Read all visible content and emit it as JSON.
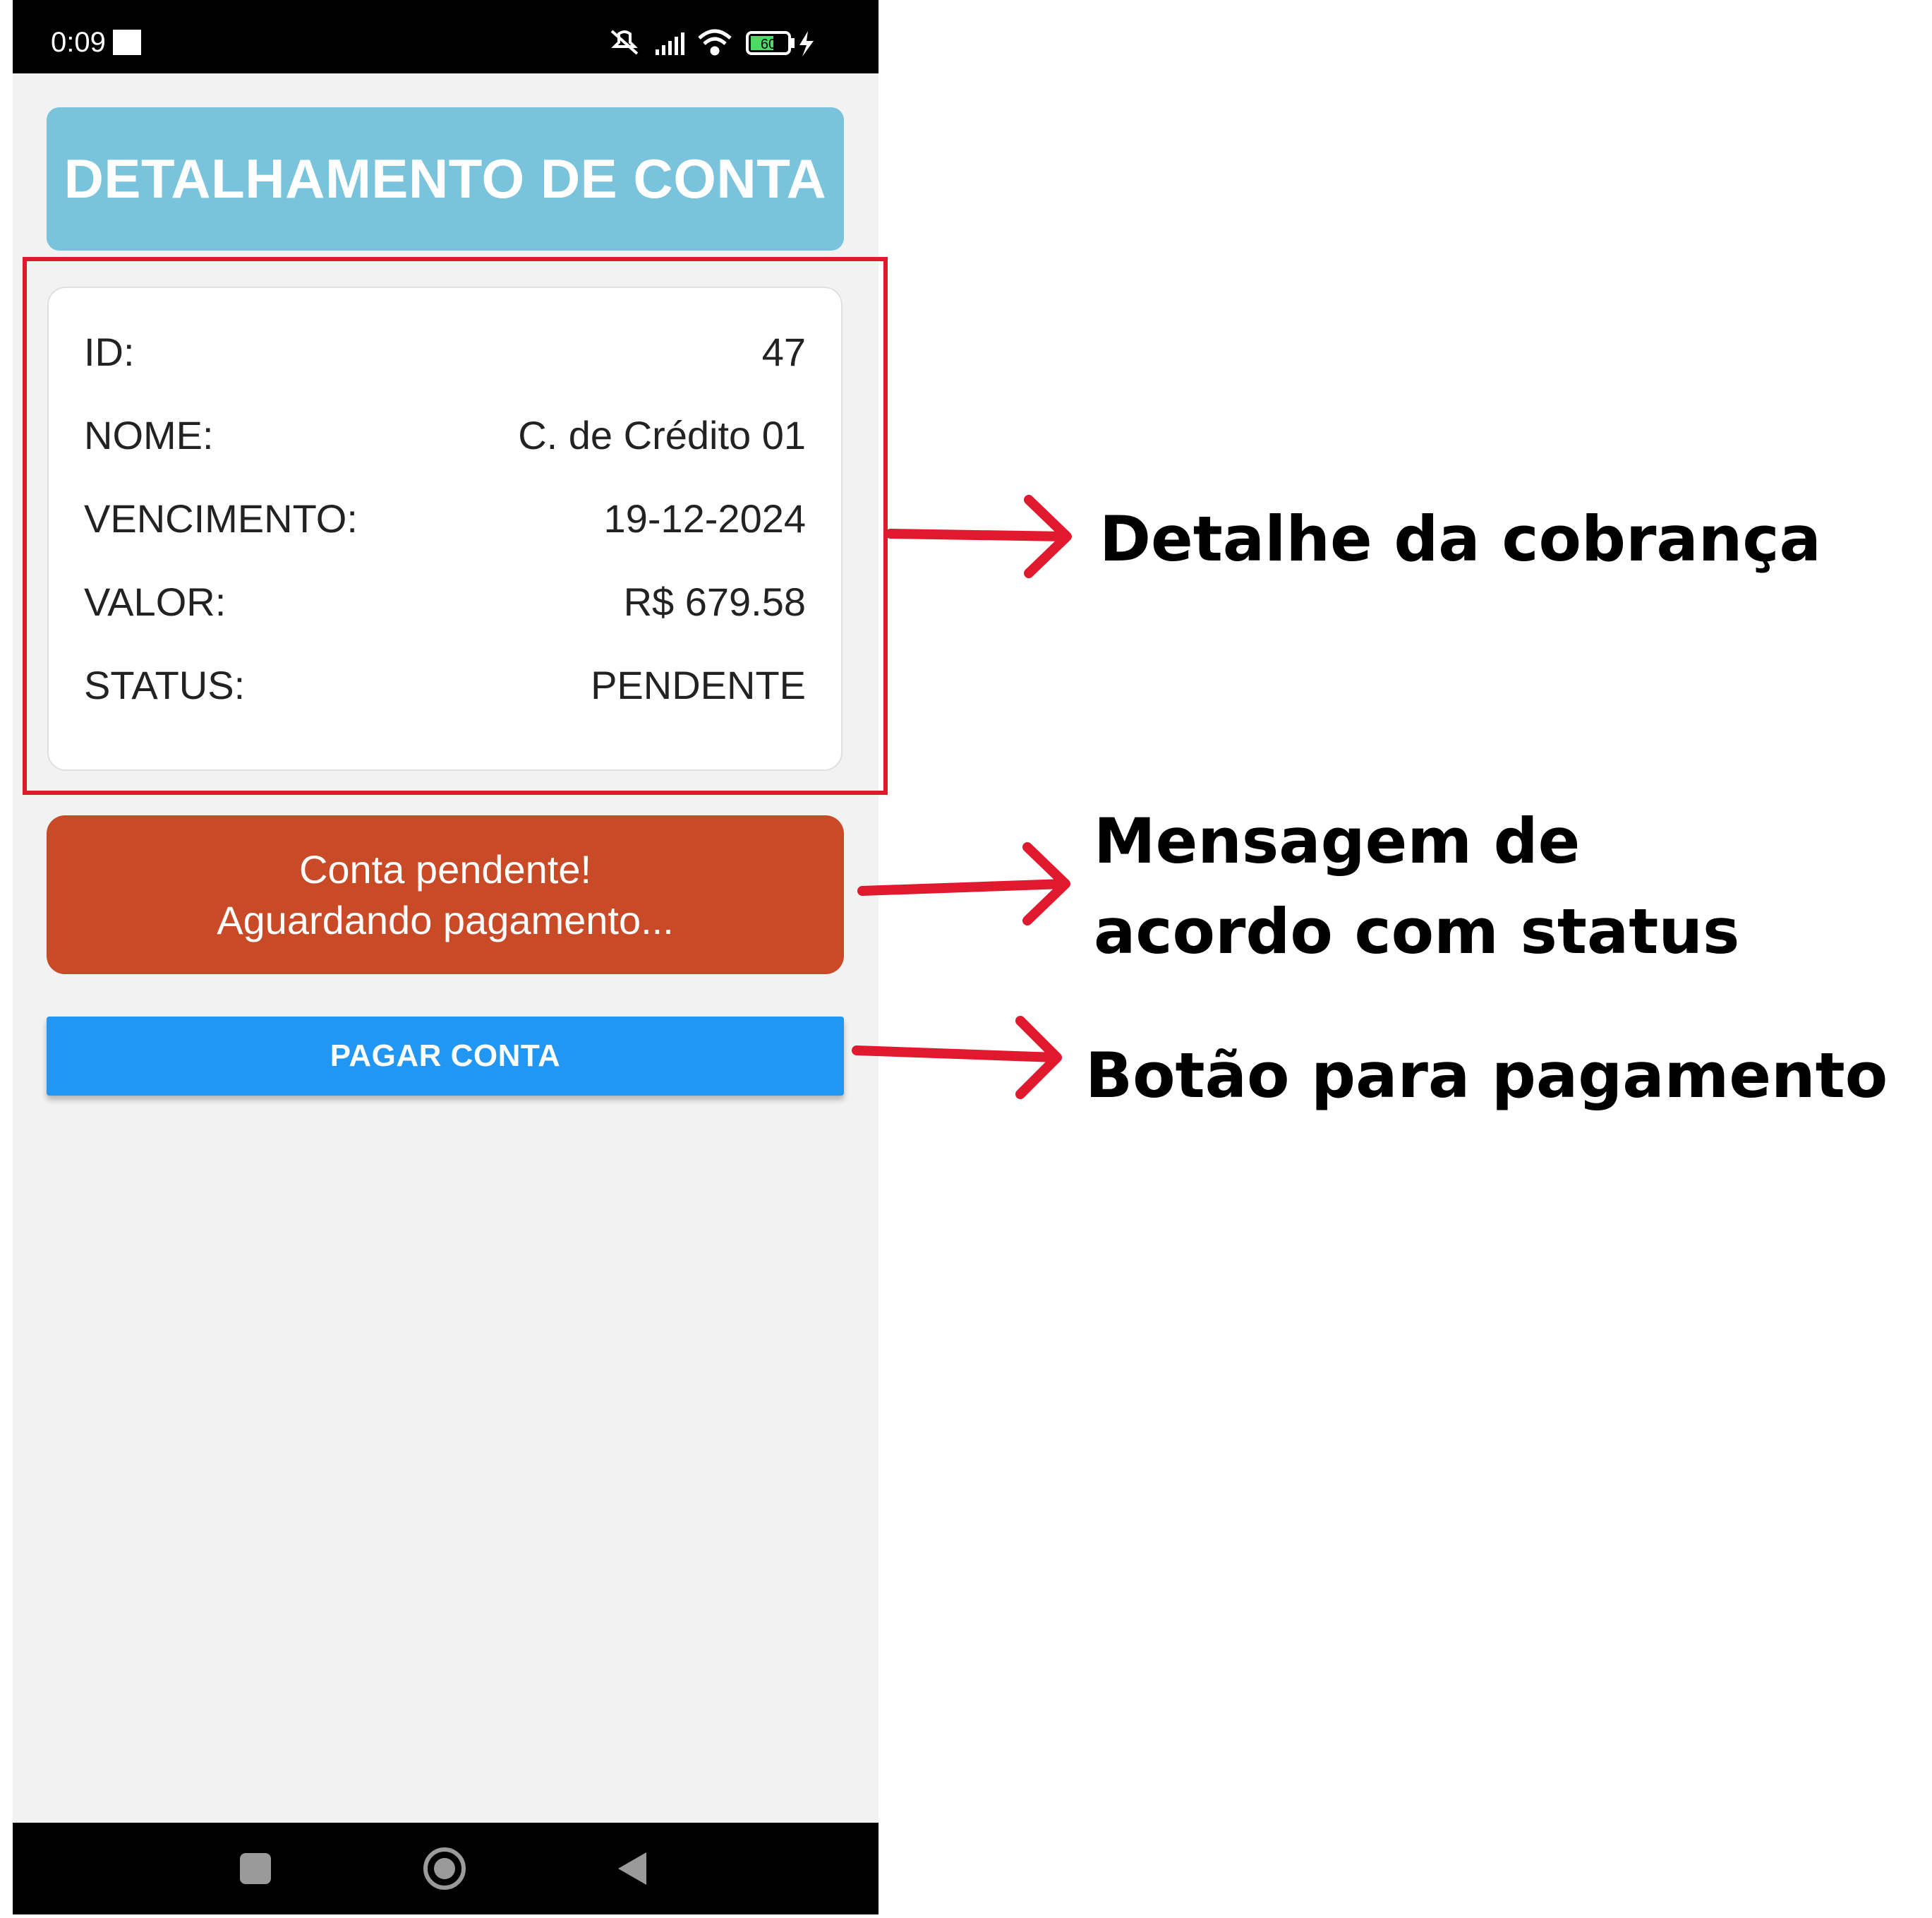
{
  "status_bar": {
    "time": "0:09",
    "battery_level": "60"
  },
  "header": {
    "title": "DETALHAMENTO DE CONTA"
  },
  "details": {
    "rows": [
      {
        "label": "ID:",
        "value": "47"
      },
      {
        "label": "NOME:",
        "value": "C. de Crédito 01"
      },
      {
        "label": "VENCIMENTO:",
        "value": "19-12-2024"
      },
      {
        "label": "VALOR:",
        "value": "R$ 679.58"
      },
      {
        "label": "STATUS:",
        "value": "PENDENTE"
      }
    ]
  },
  "alert": {
    "line1": "Conta pendente!",
    "line2": "Aguardando pagamento...",
    "color": "#c94a27"
  },
  "pay_button": {
    "label": "PAGAR CONTA",
    "color": "#2196f3"
  },
  "annotations": {
    "detail": "Detalhe da cobrança",
    "message_line1": "Mensagem de",
    "message_line2": "acordo com status",
    "button": "Botão para pagamento",
    "color": "#e0192e"
  }
}
